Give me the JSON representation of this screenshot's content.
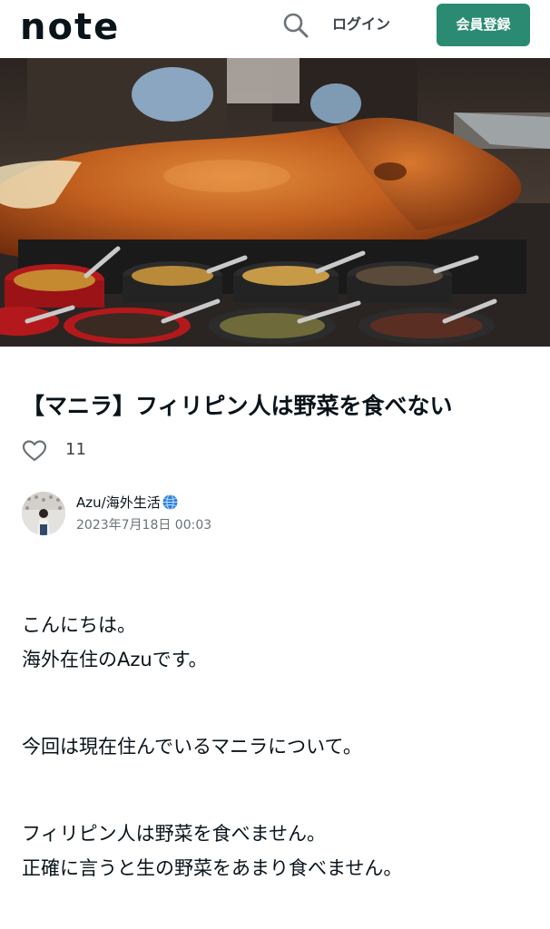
{
  "header": {
    "logo": "note",
    "login_label": "ログイン",
    "signup_label": "会員登録",
    "accent_color": "#2a8b72"
  },
  "hero": {
    "image_icon": "roast-pig-photo"
  },
  "article": {
    "title": "【マニラ】フィリピン人は野菜を食べない",
    "like_count": "11",
    "author_name": "Azu/海外生活",
    "date": "2023年7月18日 00:03",
    "paragraphs": [
      [
        "こんにちは。",
        "海外在住のAzuです。"
      ],
      [
        "今回は現在住んでいるマニラについて。"
      ],
      [
        "フィリピン人は野菜を食べません。",
        "正確に言うと生の野菜をあまり食べません。"
      ]
    ]
  }
}
